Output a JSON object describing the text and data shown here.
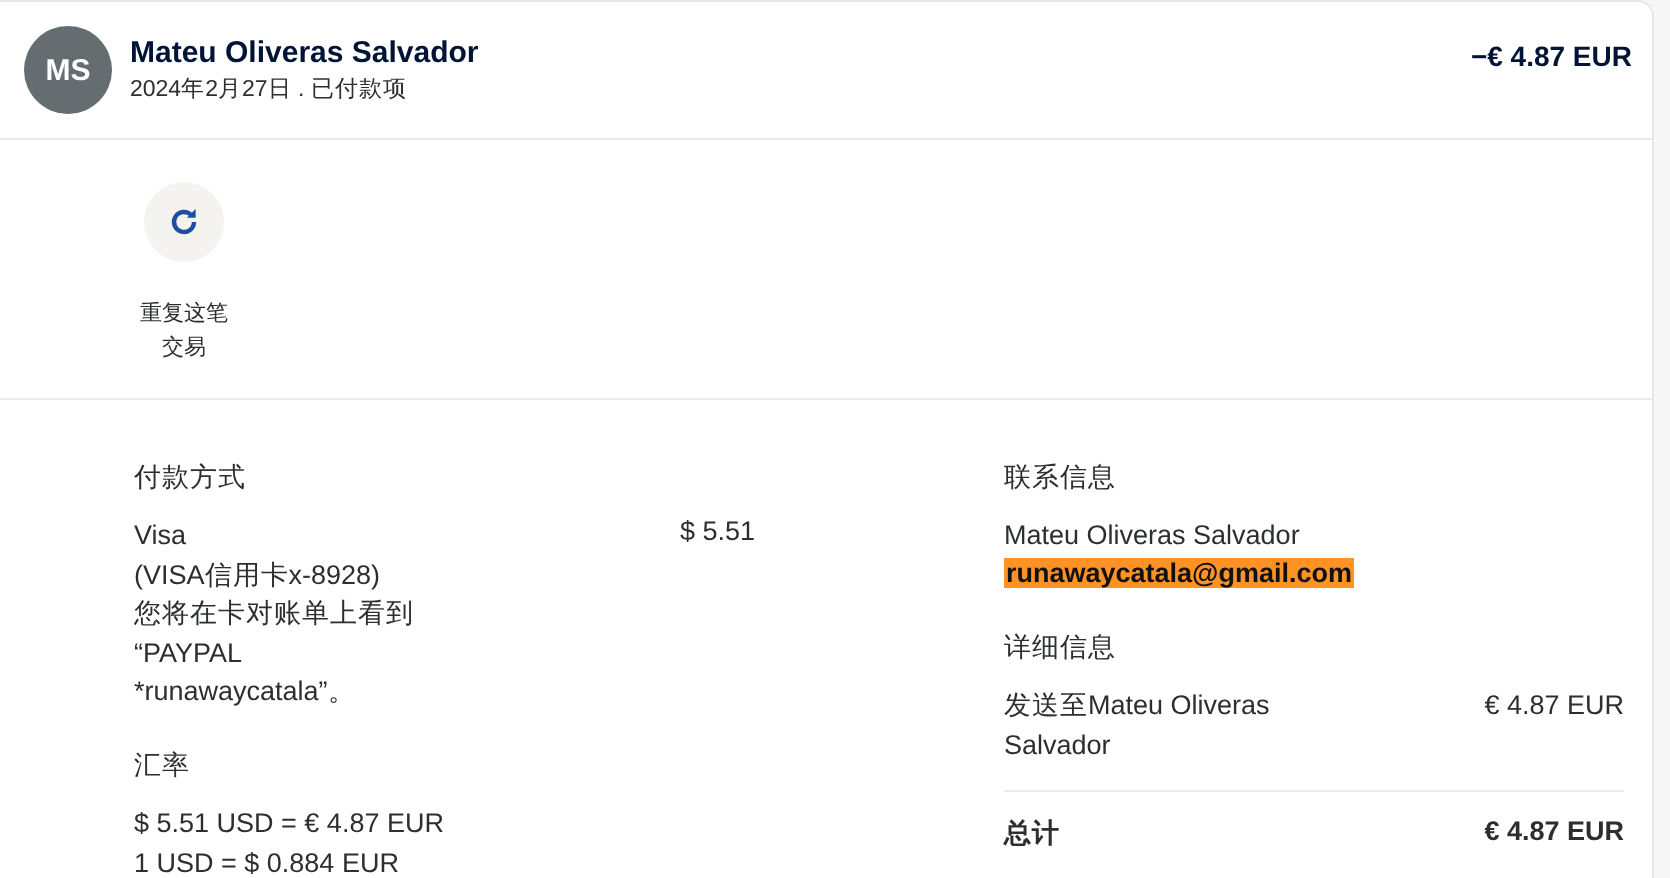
{
  "header": {
    "avatar": "MS",
    "name": "Mateu Oliveras Salvador",
    "subtitle": "2024年2月27日 . 已付款项",
    "amount": "−€ 4.87 EUR"
  },
  "actions": [
    {
      "label": "重复这笔交易"
    }
  ],
  "payment": {
    "heading": "付款方式",
    "lines": [
      "Visa",
      "(VISA信用卡x-8928)",
      "您将在卡对账单上看到",
      "“PAYPAL",
      "*runawaycatala”。"
    ],
    "amount": "$ 5.51"
  },
  "exchange": {
    "heading": "汇率",
    "lines": [
      "$ 5.51 USD = € 4.87 EUR",
      "1 USD = $ 0.884 EUR"
    ]
  },
  "contact": {
    "heading": "联系信息",
    "name": "Mateu Oliveras Salvador",
    "email": "runawaycatala@gmail.com",
    "email_highlighted": true
  },
  "details": {
    "heading": "详细信息",
    "rows": [
      {
        "label": "发送至Mateu Oliveras Salvador",
        "value": "€ 4.87 EUR"
      }
    ],
    "total_label": "总计",
    "total_value": "€ 4.87 EUR"
  }
}
